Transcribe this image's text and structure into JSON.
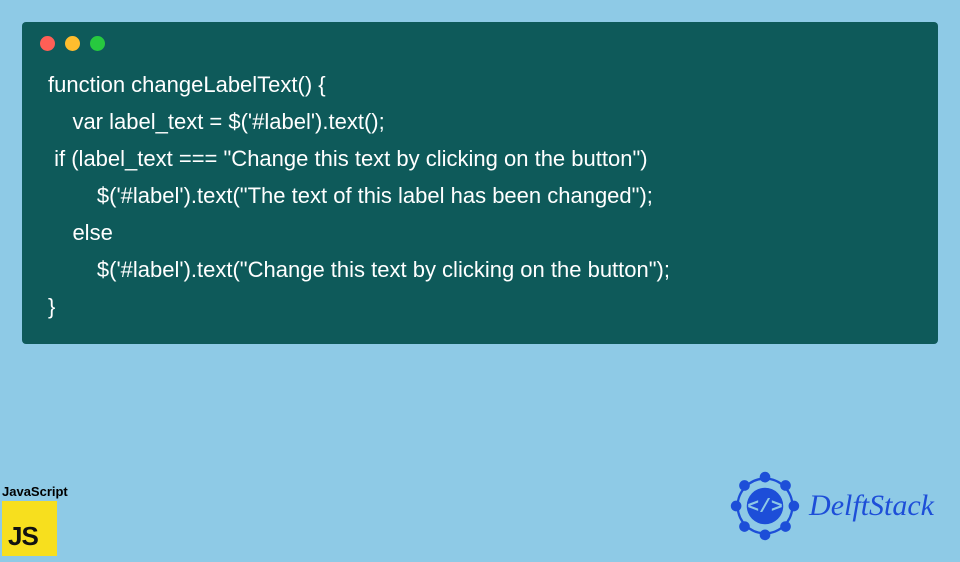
{
  "code": {
    "lines": [
      "function changeLabelText() {",
      "    var label_text = $('#label').text();",
      " if (label_text === \"Change this text by clicking on the button\")",
      "        $('#label').text(\"The text of this label has been changed\");",
      "    else",
      "        $('#label').text(\"Change this text by clicking on the button\");",
      "}"
    ]
  },
  "badges": {
    "left_label": "JavaScript",
    "left_abbrev": "JS",
    "right_brand": "DelftStack"
  },
  "colors": {
    "background": "#8ecae6",
    "code_bg": "#0e5a5a",
    "code_fg": "#ffffff",
    "js_bg": "#f7df1e",
    "brand": "#1d4ed8"
  }
}
